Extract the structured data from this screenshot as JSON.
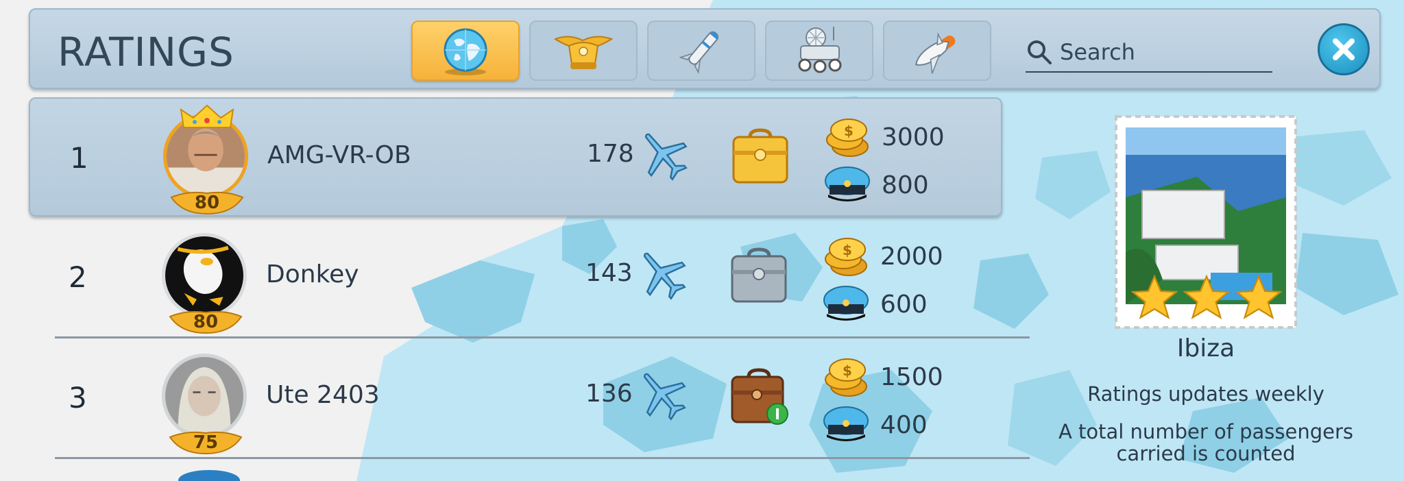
{
  "header": {
    "title": "RATINGS",
    "tabs": [
      {
        "icon": "globe-icon",
        "active": true
      },
      {
        "icon": "pilot-cap-wings-icon",
        "active": false
      },
      {
        "icon": "rocket-icon",
        "active": false
      },
      {
        "icon": "lunar-rover-icon",
        "active": false
      },
      {
        "icon": "space-shuttle-icon",
        "active": false
      }
    ],
    "search": {
      "placeholder": "Search",
      "value": ""
    },
    "close_icon": "close-icon"
  },
  "players": [
    {
      "rank": "1",
      "name": "AMG-VR-OB",
      "level": "80",
      "planes": "178",
      "coins": "3000",
      "caps": "800",
      "case": "gold",
      "highlight": true,
      "crown": true
    },
    {
      "rank": "2",
      "name": "Donkey",
      "level": "80",
      "planes": "143",
      "coins": "2000",
      "caps": "600",
      "case": "silver",
      "highlight": false,
      "crown": false
    },
    {
      "rank": "3",
      "name": "Ute 2403",
      "level": "75",
      "planes": "136",
      "coins": "1500",
      "caps": "400",
      "case": "bronze",
      "highlight": false,
      "crown": false
    }
  ],
  "side_panel": {
    "city": "Ibiza",
    "stars": 3,
    "note_weekly": "Ratings updates weekly",
    "note_total": "A total number of passengers carried is counted"
  },
  "colors": {
    "header_bg": "#b9cede",
    "active_tab": "#f7b83f",
    "close_button": "#2aa6d6",
    "map_water": "#bfe6f5",
    "map_land": "#8fd0e6"
  }
}
